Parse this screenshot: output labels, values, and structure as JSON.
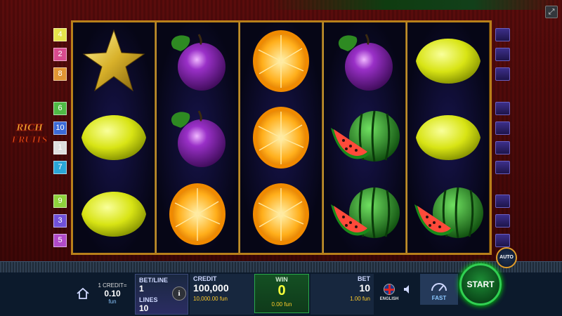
{
  "game": {
    "logo_line1": "RICH",
    "logo_line2": "FRUITS"
  },
  "line_numbers_left": [
    {
      "n": "4",
      "color": "#e5e34a"
    },
    {
      "n": "2",
      "color": "#d84b8e"
    },
    {
      "n": "8",
      "color": "#e09533"
    },
    {
      "n": "6",
      "color": "#4fba45"
    },
    {
      "n": "10",
      "color": "#3b6ad8"
    },
    {
      "n": "1",
      "color": "#dedede"
    },
    {
      "n": "7",
      "color": "#2aa6d6"
    },
    {
      "n": "9",
      "color": "#8ed23c"
    },
    {
      "n": "3",
      "color": "#7050d8"
    },
    {
      "n": "5",
      "color": "#b04ac8"
    }
  ],
  "reels": [
    [
      "star",
      "lemon",
      "lemon"
    ],
    [
      "plum",
      "plum",
      "orange"
    ],
    [
      "orange",
      "orange",
      "orange"
    ],
    [
      "plum",
      "watermelon",
      "watermelon"
    ],
    [
      "lemon",
      "lemon",
      "watermelon"
    ]
  ],
  "bottom_bar": {
    "credit_label": "1 CREDIT=",
    "credit_value": "0.10",
    "credit_unit": "fun",
    "bet_line_label": "BET/LINE",
    "bet_line_value": "1",
    "lines_label": "LINES",
    "lines_value": "10",
    "info_label": "i",
    "credit_title": "CREDIT",
    "credit_amount": "100,000",
    "credit_fun": "10,000.00 fun",
    "win_title": "WIN",
    "win_amount": "0",
    "win_fun": "0.00 fun",
    "bet_title": "BET",
    "bet_amount": "10",
    "bet_fun": "1.00 fun",
    "language": "ENGLISH",
    "fast_label": "FAST",
    "start_label": "START",
    "auto_label": "AUTO"
  },
  "colors": {
    "frame_gold": "#b8801a",
    "start_green": "#31d052",
    "win_yellow": "#f7ff3a"
  }
}
